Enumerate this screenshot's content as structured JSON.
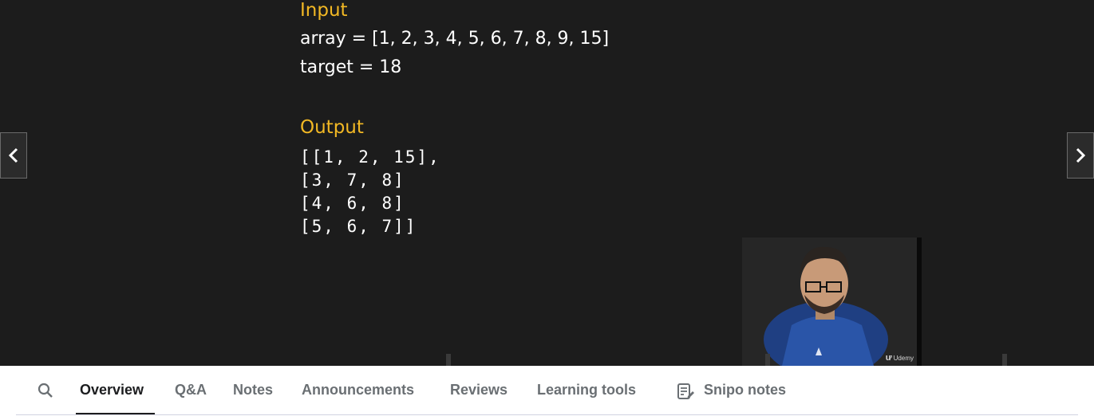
{
  "slide": {
    "input_heading": "Input",
    "array_line": "array = [1, 2, 3, 4, 5, 6, 7, 8, 9, 15]",
    "target_line": "target = 18",
    "output_heading": "Output",
    "output_lines": [
      "[[1, 2, 15],",
      "[3, 7, 8]",
      "[4, 6, 8]",
      "[5, 6, 7]]"
    ]
  },
  "presenter": {
    "watermark": "Udemy",
    "watermark_glyph": "ư"
  },
  "nav": {
    "prev_icon": "chevron-left-icon",
    "next_icon": "chevron-right-icon"
  },
  "tabs": {
    "search_icon": "search-icon",
    "items": [
      {
        "label": "Overview",
        "active": true
      },
      {
        "label": "Q&A"
      },
      {
        "label": "Notes"
      },
      {
        "label": "Announcements"
      },
      {
        "label": "Reviews"
      },
      {
        "label": "Learning tools"
      },
      {
        "label": "Snipo notes",
        "icon": "notes-icon"
      }
    ]
  },
  "colors": {
    "accent_heading": "#f2b824",
    "video_background": "#1c1c1c",
    "tab_active": "#1c1d1f",
    "tab_inactive": "#6a6f73"
  }
}
